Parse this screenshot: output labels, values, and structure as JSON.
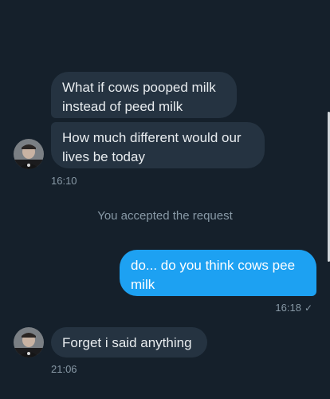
{
  "messages": {
    "m1": "What if cows pooped milk instead of peed milk",
    "m2": "How much different would our lives be today",
    "m3": "do... do you think cows pee milk",
    "m4": "Forget i said anything"
  },
  "timestamps": {
    "t1": "16:10",
    "t2": "16:18",
    "t3": "21:06"
  },
  "system_text": "You accepted the request",
  "read_receipt_icon": "✓",
  "colors": {
    "background": "#15202b",
    "incoming_bubble": "#253341",
    "outgoing_bubble": "#1da1f2",
    "muted_text": "#8899a6"
  }
}
